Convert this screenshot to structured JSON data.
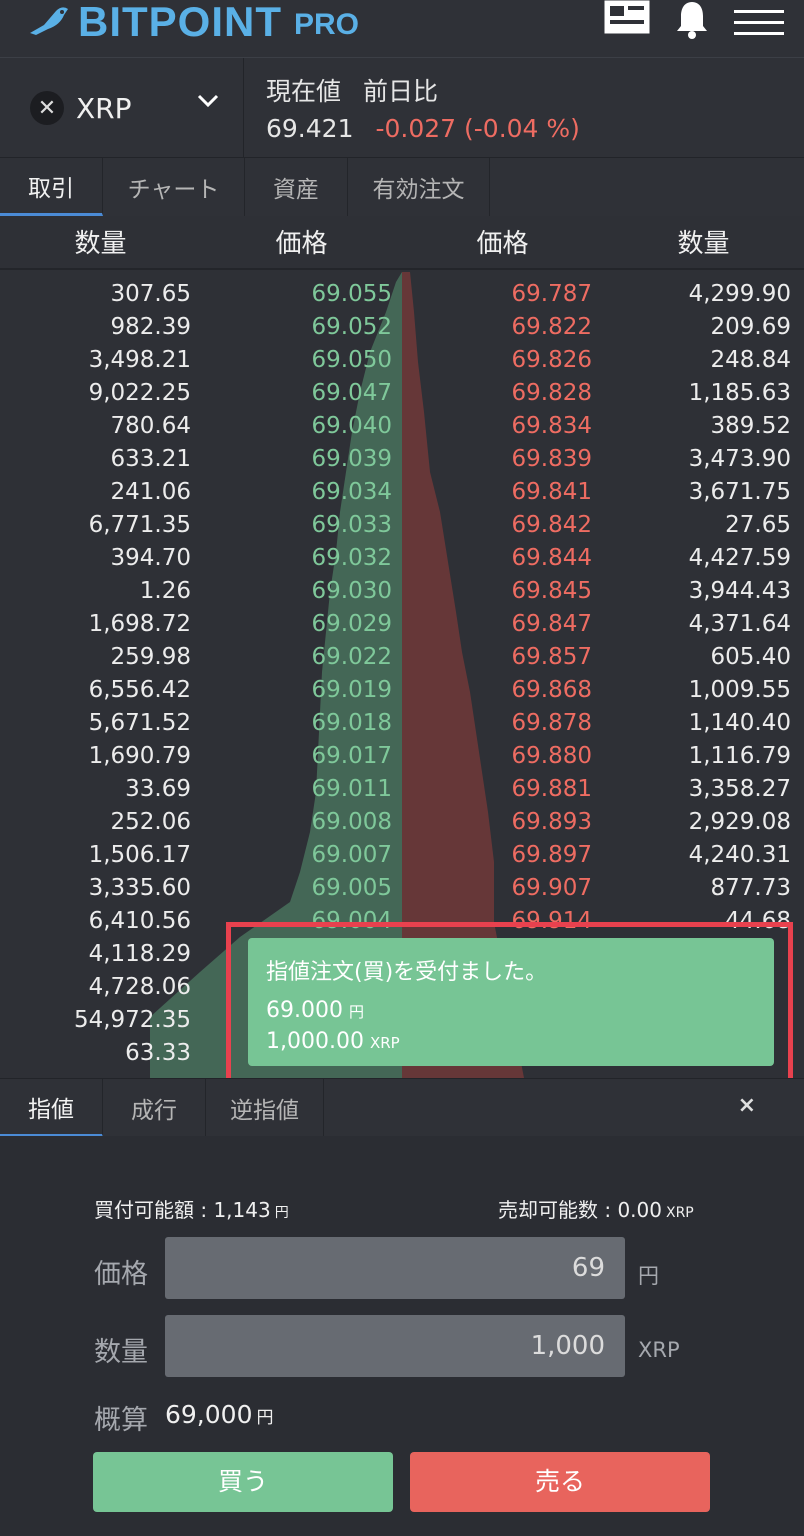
{
  "header": {
    "logo_text": "BITPOINT",
    "logo_suffix": "PRO",
    "icons": [
      "layout-icon",
      "bell-icon",
      "menu-icon"
    ],
    "brand_color": "#5ab0e6"
  },
  "ticker": {
    "pair": "XRP",
    "pair_icon": "xrp-icon",
    "label_price": "現在値",
    "label_change": "前日比",
    "price": "69.421",
    "change": "-0.027 (-0.04 %)"
  },
  "tabs": [
    "取引",
    "チャート",
    "資産",
    "有効注文"
  ],
  "book": {
    "headers": [
      "数量",
      "価格",
      "価格",
      "数量"
    ],
    "rows": [
      {
        "bq": "307.65",
        "bp": "69.055",
        "ap": "69.787",
        "aq": "4,299.90"
      },
      {
        "bq": "982.39",
        "bp": "69.052",
        "ap": "69.822",
        "aq": "209.69"
      },
      {
        "bq": "3,498.21",
        "bp": "69.050",
        "ap": "69.826",
        "aq": "248.84"
      },
      {
        "bq": "9,022.25",
        "bp": "69.047",
        "ap": "69.828",
        "aq": "1,185.63"
      },
      {
        "bq": "780.64",
        "bp": "69.040",
        "ap": "69.834",
        "aq": "389.52"
      },
      {
        "bq": "633.21",
        "bp": "69.039",
        "ap": "69.839",
        "aq": "3,473.90"
      },
      {
        "bq": "241.06",
        "bp": "69.034",
        "ap": "69.841",
        "aq": "3,671.75"
      },
      {
        "bq": "6,771.35",
        "bp": "69.033",
        "ap": "69.842",
        "aq": "27.65"
      },
      {
        "bq": "394.70",
        "bp": "69.032",
        "ap": "69.844",
        "aq": "4,427.59"
      },
      {
        "bq": "1.26",
        "bp": "69.030",
        "ap": "69.845",
        "aq": "3,944.43"
      },
      {
        "bq": "1,698.72",
        "bp": "69.029",
        "ap": "69.847",
        "aq": "4,371.64"
      },
      {
        "bq": "259.98",
        "bp": "69.022",
        "ap": "69.857",
        "aq": "605.40"
      },
      {
        "bq": "6,556.42",
        "bp": "69.019",
        "ap": "69.868",
        "aq": "1,009.55"
      },
      {
        "bq": "5,671.52",
        "bp": "69.018",
        "ap": "69.878",
        "aq": "1,140.40"
      },
      {
        "bq": "1,690.79",
        "bp": "69.017",
        "ap": "69.880",
        "aq": "1,116.79"
      },
      {
        "bq": "33.69",
        "bp": "69.011",
        "ap": "69.881",
        "aq": "3,358.27"
      },
      {
        "bq": "252.06",
        "bp": "69.008",
        "ap": "69.893",
        "aq": "2,929.08"
      },
      {
        "bq": "1,506.17",
        "bp": "69.007",
        "ap": "69.897",
        "aq": "4,240.31"
      },
      {
        "bq": "3,335.60",
        "bp": "69.005",
        "ap": "69.907",
        "aq": "877.73"
      },
      {
        "bq": "6,410.56",
        "bp": "69.004",
        "ap": "69.914",
        "aq": "44.68"
      },
      {
        "bq": "4,118.29",
        "bp": "",
        "ap": "",
        "aq": ""
      },
      {
        "bq": "4,728.06",
        "bp": "",
        "ap": "",
        "aq": ""
      },
      {
        "bq": "54,972.35",
        "bp": "",
        "ap": "",
        "aq": ""
      },
      {
        "bq": "63.33",
        "bp": "",
        "ap": "",
        "aq": ""
      }
    ],
    "bid_color": "#7fc89a",
    "ask_color": "#ee6c62"
  },
  "toast": {
    "title": "指値注文(買)を受付ました。",
    "price": "69.000",
    "price_unit": "円",
    "amount": "1,000.00",
    "amount_unit": "XRP",
    "color": "#77c595"
  },
  "order_tabs": [
    "指値",
    "成行",
    "逆指値"
  ],
  "close_label": "×",
  "form": {
    "buy_avail_label": "買付可能額 : 1,143",
    "buy_avail_unit": "円",
    "sell_avail_label": "売却可能数 : 0.00",
    "sell_avail_unit": "XRP",
    "price_label": "価格",
    "price_value": "69",
    "price_unit": "円",
    "qty_label": "数量",
    "qty_value": "1,000",
    "qty_unit": "XRP",
    "estimate_label": "概算",
    "estimate_value": "69,000",
    "estimate_unit": "円",
    "buy_label": "買う",
    "sell_label": "売る"
  }
}
